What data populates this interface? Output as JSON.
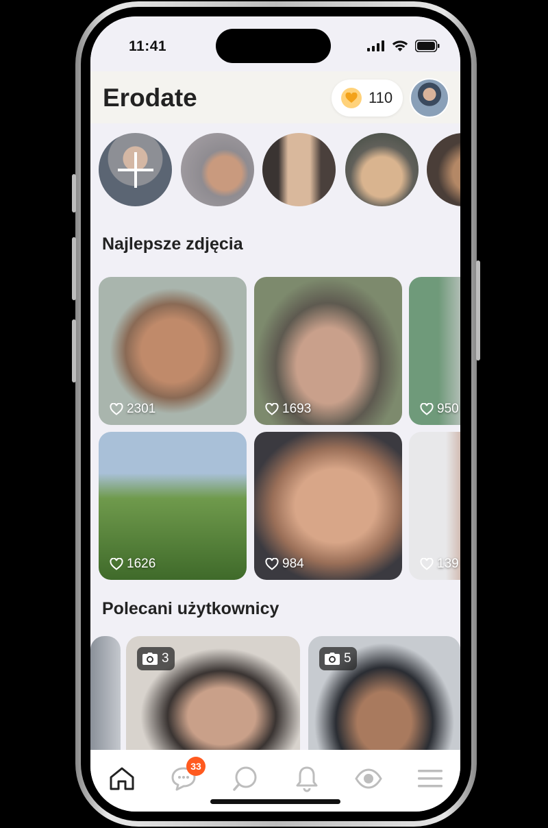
{
  "status": {
    "time": "11:41"
  },
  "header": {
    "brand": "Erodate",
    "coins": "110"
  },
  "stories": [
    {
      "name": "add-story",
      "icon": "plus-icon"
    },
    {
      "name": "story-1"
    },
    {
      "name": "story-2"
    },
    {
      "name": "story-3"
    },
    {
      "name": "story-4"
    }
  ],
  "best_photos": {
    "title": "Najlepsze zdjęcia",
    "tiles": [
      {
        "likes": "2301"
      },
      {
        "likes": "1693"
      },
      {
        "likes": "950"
      },
      {
        "likes": "1626"
      },
      {
        "likes": "984"
      },
      {
        "likes": "139"
      }
    ]
  },
  "recommended": {
    "title": "Polecani użytkownicy",
    "cards": [
      {
        "photos": "3"
      },
      {
        "photos": "5"
      }
    ]
  },
  "tabbar": {
    "items": [
      "home-icon",
      "messages-icon",
      "search-icon",
      "bell-icon",
      "eye-icon",
      "menu-icon"
    ],
    "messages_badge": "33"
  },
  "colors": {
    "accent": "#ff5a1f",
    "coin": "#f3a21a",
    "background": "#f1f0f6"
  }
}
